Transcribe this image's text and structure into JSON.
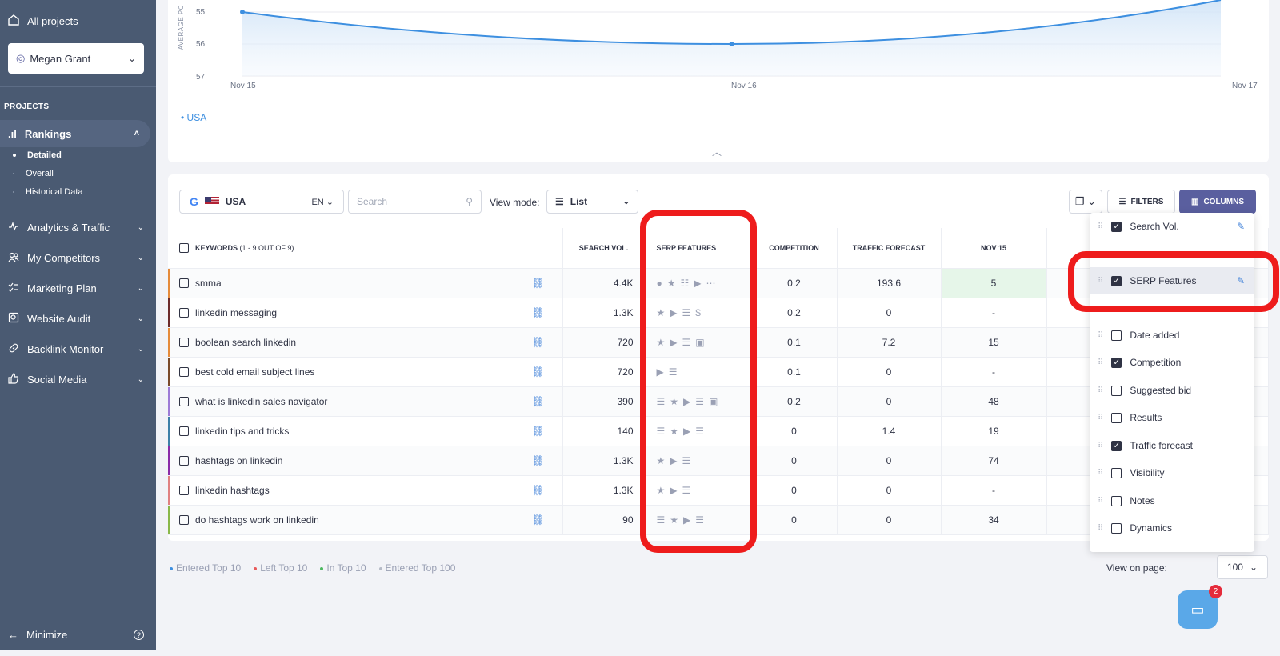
{
  "sidebar": {
    "all_projects": "All projects",
    "user": "Megan Grant",
    "projects_heading": "PROJECTS",
    "rankings": "Rankings",
    "rankings_sub": [
      "Detailed",
      "Overall",
      "Historical Data"
    ],
    "items": [
      "Analytics & Traffic",
      "My Competitors",
      "Marketing Plan",
      "Website Audit",
      "Backlink Monitor",
      "Social Media"
    ],
    "minimize": "Minimize"
  },
  "chart": {
    "y_label": "AVERAGE PC",
    "y_ticks": [
      "55",
      "56",
      "57"
    ],
    "x_ticks": [
      "Nov 15",
      "Nov 16",
      "Nov 17"
    ],
    "legend": "USA",
    "line_color": "#3d8fe0"
  },
  "chart_data": {
    "type": "line",
    "x": [
      "Nov 15",
      "Nov 16",
      "Nov 17"
    ],
    "series": [
      {
        "name": "USA",
        "values": [
          55,
          56,
          54.6
        ]
      }
    ],
    "ylabel": "AVERAGE PC",
    "ylim": [
      57,
      55
    ],
    "grid": true
  },
  "toolbar": {
    "region": "USA",
    "lang": "EN",
    "search_placeholder": "Search",
    "view_mode_label": "View mode:",
    "view_mode_value": "List",
    "filters": "FILTERS",
    "columns": "COLUMNS"
  },
  "table": {
    "headers": {
      "keywords": "KEYWORDS",
      "keywords_count": "(1 - 9 OUT OF 9)",
      "search_vol": "SEARCH VOL.",
      "serp": "SERP FEATURES",
      "competition": "COMPETITION",
      "traffic": "TRAFFIC FORECAST",
      "nov15": "NOV 15"
    },
    "rows": [
      {
        "keyword": "smma",
        "vol": "4.4K",
        "serp": "●★☷▶⋯",
        "comp": "0.2",
        "traffic": "193.6",
        "nov15": "5"
      },
      {
        "keyword": "linkedin messaging",
        "vol": "1.3K",
        "serp": "★▶☰$",
        "comp": "0.2",
        "traffic": "0",
        "nov15": "-"
      },
      {
        "keyword": "boolean search linkedin",
        "vol": "720",
        "serp": "★▶☰▣",
        "comp": "0.1",
        "traffic": "7.2",
        "nov15": "15"
      },
      {
        "keyword": "best cold email subject lines",
        "vol": "720",
        "serp": "▶☰",
        "comp": "0.1",
        "traffic": "0",
        "nov15": "-"
      },
      {
        "keyword": "what is linkedin sales navigator",
        "vol": "390",
        "serp": "☰★▶☰▣",
        "comp": "0.2",
        "traffic": "0",
        "nov15": "48"
      },
      {
        "keyword": "linkedin tips and tricks",
        "vol": "140",
        "serp": "☰★▶☰",
        "comp": "0",
        "traffic": "1.4",
        "nov15": "19"
      },
      {
        "keyword": "hashtags on linkedin",
        "vol": "1.3K",
        "serp": "★▶☰",
        "comp": "0",
        "traffic": "0",
        "nov15": "74"
      },
      {
        "keyword": "linkedin hashtags",
        "vol": "1.3K",
        "serp": "★▶☰",
        "comp": "0",
        "traffic": "0",
        "nov15": "-"
      },
      {
        "keyword": "do hashtags work on linkedin",
        "vol": "90",
        "serp": "☰★▶☰",
        "comp": "0",
        "traffic": "0",
        "nov15": "34"
      }
    ]
  },
  "legend_bottom": [
    "Entered Top 10",
    "Left Top 10",
    "In Top 10",
    "Entered Top 100"
  ],
  "view_on_page": {
    "label": "View on page:",
    "value": "100"
  },
  "columns_menu": [
    {
      "label": "Search Vol.",
      "checked": true,
      "pinned": true
    },
    {
      "label": "SERP Features",
      "checked": true,
      "pinned": true
    },
    {
      "label": "Date added",
      "checked": false
    },
    {
      "label": "Competition",
      "checked": true
    },
    {
      "label": "Suggested bid",
      "checked": false
    },
    {
      "label": "Results",
      "checked": false
    },
    {
      "label": "Traffic forecast",
      "checked": true
    },
    {
      "label": "Visibility",
      "checked": false
    },
    {
      "label": "Notes",
      "checked": false
    },
    {
      "label": "Dynamics",
      "checked": false
    }
  ],
  "chat_badge": "2",
  "highlight_color": "#ee1c1c"
}
